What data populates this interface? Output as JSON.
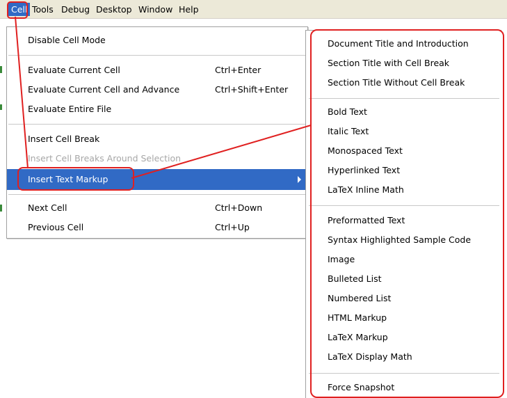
{
  "menubar": {
    "items": [
      {
        "label": "Cell"
      },
      {
        "label": "Tools"
      },
      {
        "label": "Debug"
      },
      {
        "label": "Desktop"
      },
      {
        "label": "Window"
      },
      {
        "label": "Help"
      }
    ]
  },
  "cell_menu": {
    "items": [
      {
        "label": "Disable Cell Mode",
        "shortcut": ""
      },
      {
        "label": "Evaluate Current Cell",
        "shortcut": "Ctrl+Enter"
      },
      {
        "label": "Evaluate Current Cell and Advance",
        "shortcut": "Ctrl+Shift+Enter"
      },
      {
        "label": "Evaluate Entire File",
        "shortcut": ""
      },
      {
        "label": "Insert Cell Break",
        "shortcut": ""
      },
      {
        "label": "Insert Cell Breaks Around Selection",
        "shortcut": "",
        "disabled": true
      },
      {
        "label": "Insert Text Markup",
        "shortcut": "",
        "selected": true
      },
      {
        "label": "Next Cell",
        "shortcut": "Ctrl+Down"
      },
      {
        "label": "Previous Cell",
        "shortcut": "Ctrl+Up"
      }
    ]
  },
  "submenu": {
    "items": [
      {
        "label": "Document Title and Introduction"
      },
      {
        "label": "Section Title with Cell Break"
      },
      {
        "label": "Section Title Without Cell Break"
      },
      {
        "label": "Bold Text"
      },
      {
        "label": "Italic Text"
      },
      {
        "label": "Monospaced Text"
      },
      {
        "label": "Hyperlinked Text"
      },
      {
        "label": "LaTeX Inline Math"
      },
      {
        "label": "Preformatted Text"
      },
      {
        "label": "Syntax Highlighted Sample Code"
      },
      {
        "label": "Image"
      },
      {
        "label": "Bulleted List"
      },
      {
        "label": "Numbered List"
      },
      {
        "label": "HTML Markup"
      },
      {
        "label": "LaTeX Markup"
      },
      {
        "label": "LaTeX Display Math"
      },
      {
        "label": "Force Snapshot"
      }
    ]
  },
  "colors": {
    "selection": "#316ac5",
    "annotation": "#e02020",
    "menubar_bg": "#ece9d8",
    "disabled_text": "#a7a7a7"
  },
  "icons": {
    "submenu_arrow": "chevron-right-icon"
  }
}
